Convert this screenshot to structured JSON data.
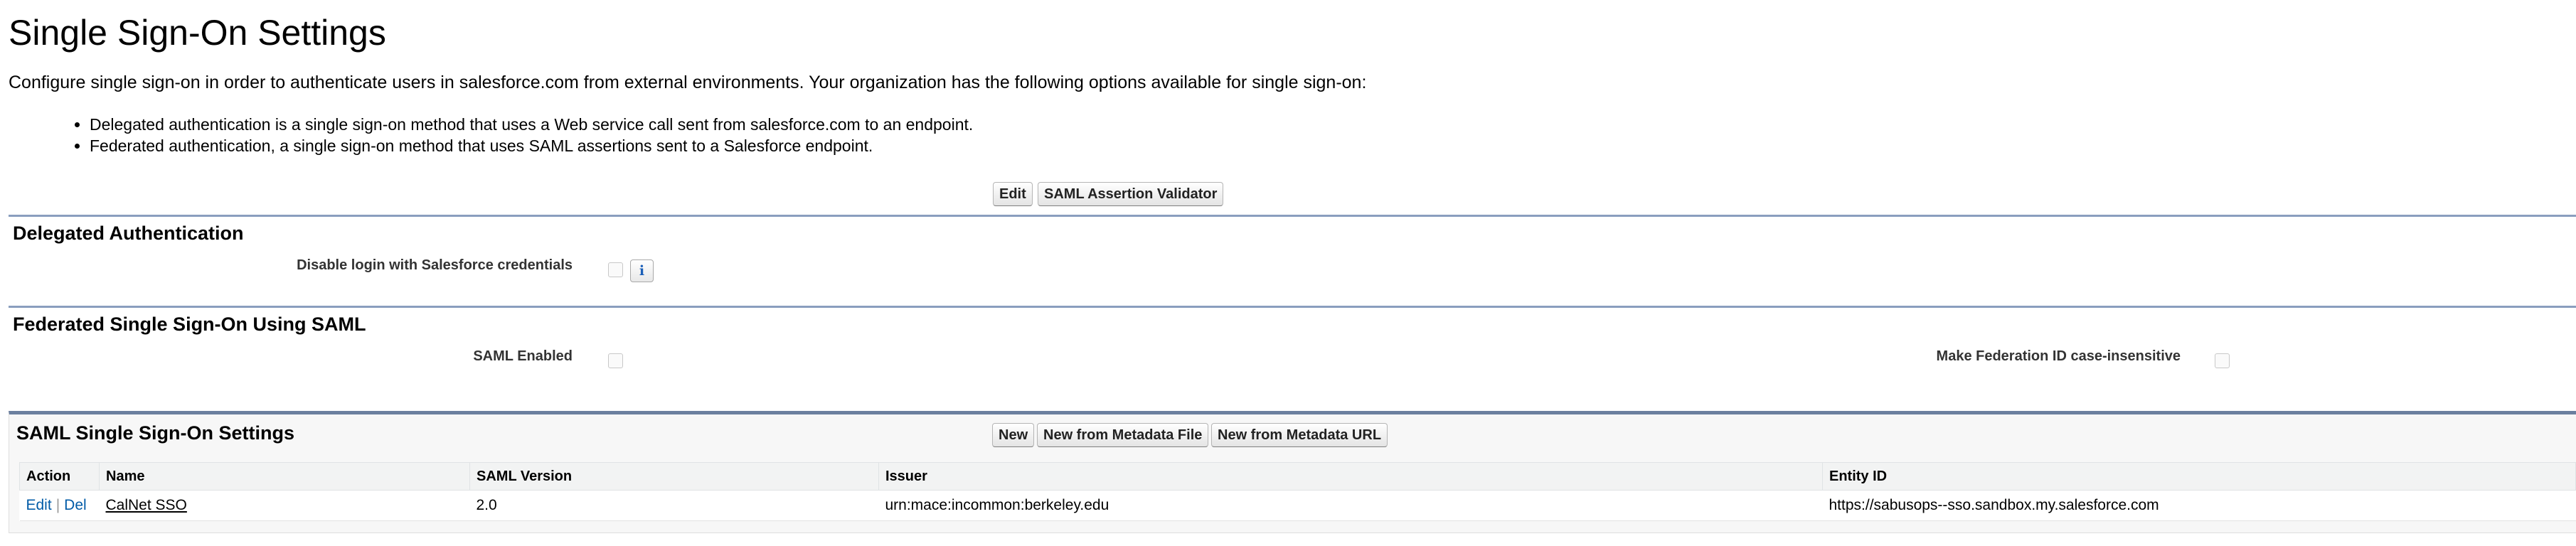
{
  "page": {
    "title": "Single Sign-On Settings",
    "intro": "Configure single sign-on in order to authenticate users in salesforce.com from external environments. Your organization has the following options available for single sign-on:",
    "bullets": [
      "Delegated authentication is a single sign-on method that uses a Web service call sent from salesforce.com to an endpoint.",
      "Federated authentication, a single sign-on method that uses SAML assertions sent to a Salesforce endpoint."
    ]
  },
  "toolbar": {
    "edit_label": "Edit",
    "validator_label": "SAML Assertion Validator"
  },
  "delegated": {
    "title": "Delegated Authentication",
    "disable_login_label": "Disable login with Salesforce credentials",
    "disable_login_checked": false,
    "info_icon": "info-icon"
  },
  "federated": {
    "title": "Federated Single Sign-On Using SAML",
    "saml_enabled_label": "SAML Enabled",
    "saml_enabled_checked": false,
    "case_insensitive_label": "Make Federation ID case-insensitive",
    "case_insensitive_checked": false
  },
  "saml_settings": {
    "title": "SAML Single Sign-On Settings",
    "buttons": {
      "new": "New",
      "new_from_file": "New from Metadata File",
      "new_from_url": "New from Metadata URL"
    },
    "columns": {
      "action": "Action",
      "name": "Name",
      "version": "SAML Version",
      "issuer": "Issuer",
      "entity_id": "Entity ID"
    },
    "rows": [
      {
        "edit": "Edit",
        "separator": "|",
        "del": "Del",
        "name": "CalNet SSO",
        "version": "2.0",
        "issuer": "urn:mace:incommon:berkeley.edu",
        "entity_id": "https://sabusops--sso.sandbox.my.salesforce.com"
      }
    ]
  },
  "colors": {
    "section_rule": "#8a9ebe",
    "related_list_border": "#6b7f9f",
    "link": "#015ba7"
  }
}
